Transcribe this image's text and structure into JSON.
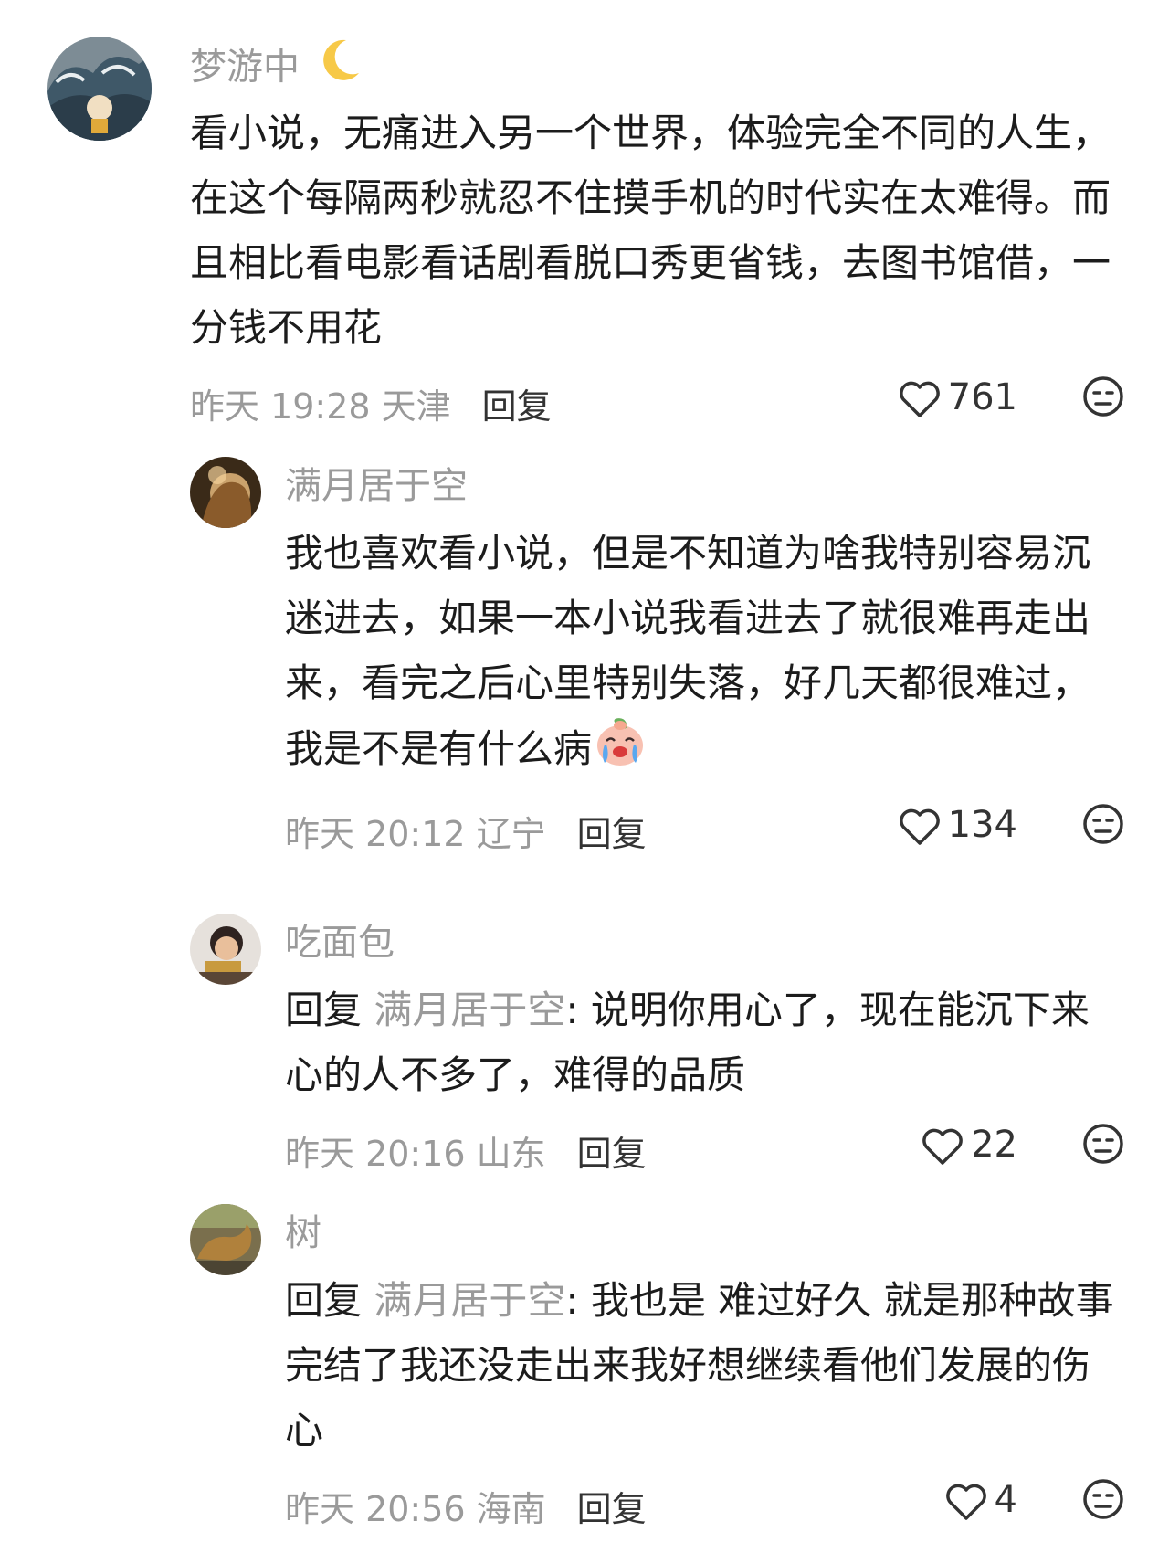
{
  "colors": {
    "name": "#9a9a9a",
    "text": "#1c1c1c",
    "meta": "#9a9a9a",
    "action": "#333333"
  },
  "comments": [
    {
      "user": "梦游中",
      "name_emoji": "crescent-moon-icon",
      "text": "看小说，无痛进入另一个世界，体验完全不同的人生，在这个每隔两秒就忍不住摸手机的时代实在太难得。而且相比看电影看话剧看脱口秀更省钱，去图书馆借，一分钱不用花",
      "time_location": "昨天 19:28 天津",
      "reply_label": "回复",
      "likes": "761",
      "dislike_icon": "dislike-face-icon"
    },
    {
      "user": "满月居于空",
      "text": "我也喜欢看小说，但是不知道为啥我特别容易沉迷进去，如果一本小说我看进去了就很难再走出来，看完之后心里特别失落，好几天都很难过，我是不是有什么病",
      "text_emoji": "crying-face-emoji-icon",
      "time_location": "昨天 20:12 辽宁",
      "reply_label": "回复",
      "likes": "134",
      "dislike_icon": "dislike-face-icon"
    },
    {
      "user": "吃面包",
      "reply_prefix": "回复",
      "reply_to": "满月居于空",
      "text": ": 说明你用心了，现在能沉下来心的人不多了，难得的品质",
      "time_location": "昨天 20:16 山东",
      "reply_label": "回复",
      "likes": "22",
      "dislike_icon": "dislike-face-icon"
    },
    {
      "user": "树",
      "reply_prefix": "回复",
      "reply_to": "满月居于空",
      "text": ": 我也是 难过好久 就是那种故事完结了我还没走出来我好想继续看他们发展的伤心",
      "time_location": "昨天 20:56 海南",
      "reply_label": "回复",
      "likes": "4",
      "dislike_icon": "dislike-face-icon"
    }
  ]
}
